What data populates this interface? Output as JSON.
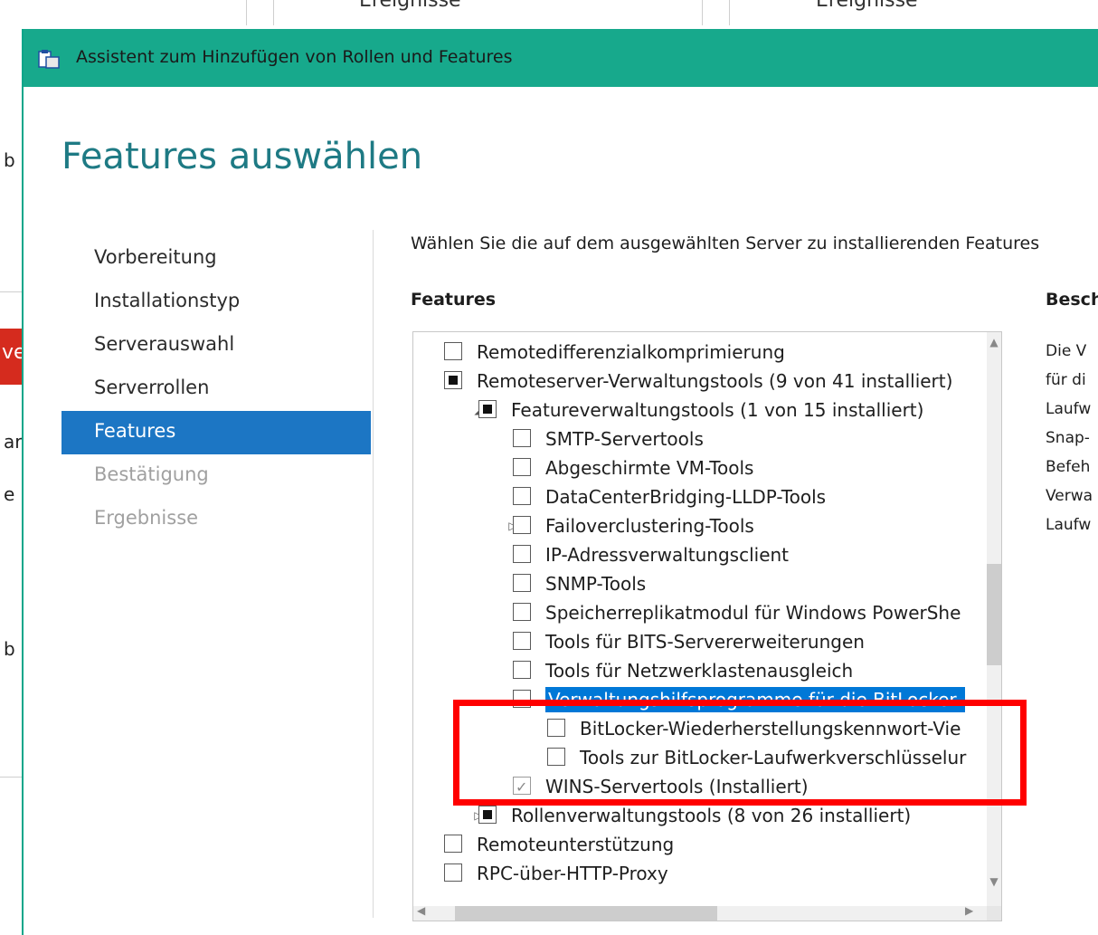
{
  "background": {
    "top_cells": [
      "Ereignisse",
      "Ereignisse"
    ],
    "left_fragments": [
      "b",
      "ar",
      "e",
      "b",
      "ve"
    ]
  },
  "window": {
    "title": "Assistent zum Hinzufügen von Rollen und Features",
    "icon": "wizard-icon",
    "accent_color": "#17a98c"
  },
  "heading": "Features auswählen",
  "nav": {
    "items": [
      {
        "label": "Vorbereitung",
        "state": "normal"
      },
      {
        "label": "Installationstyp",
        "state": "normal"
      },
      {
        "label": "Serverauswahl",
        "state": "normal"
      },
      {
        "label": "Serverrollen",
        "state": "normal"
      },
      {
        "label": "Features",
        "state": "active"
      },
      {
        "label": "Bestätigung",
        "state": "disabled"
      },
      {
        "label": "Ergebnisse",
        "state": "disabled"
      }
    ]
  },
  "main": {
    "instruction": "Wählen Sie die auf dem ausgewählten Server zu installierenden Features",
    "features_heading": "Features",
    "description_heading": "Besch",
    "description_lines": [
      "Die V",
      "für di",
      "Laufw",
      "Snap-",
      "Befeh",
      "Verwa",
      "Laufw"
    ]
  },
  "tree": {
    "items": [
      {
        "label": "Remotedifferenzialkomprimierung",
        "state": "unchecked",
        "expander": "",
        "level": 0
      },
      {
        "label": "Remoteserver-Verwaltungstools (9 von 41 installiert)",
        "state": "partial",
        "expander": "",
        "level": 0
      },
      {
        "label": "Featureverwaltungstools (1 von 15 installiert)",
        "state": "partial",
        "expander": "expanded",
        "level": 1
      },
      {
        "label": "SMTP-Servertools",
        "state": "unchecked",
        "expander": "",
        "level": 2
      },
      {
        "label": "Abgeschirmte VM-Tools",
        "state": "unchecked",
        "expander": "",
        "level": 2
      },
      {
        "label": "DataCenterBridging-LLDP-Tools",
        "state": "unchecked",
        "expander": "",
        "level": 2
      },
      {
        "label": "Failoverclustering-Tools",
        "state": "unchecked",
        "expander": "collapsed",
        "level": 2
      },
      {
        "label": "IP-Adressverwaltungsclient",
        "state": "unchecked",
        "expander": "",
        "level": 2
      },
      {
        "label": "SNMP-Tools",
        "state": "unchecked",
        "expander": "",
        "level": 2
      },
      {
        "label": "Speicherreplikatmodul für Windows PowerShe",
        "state": "unchecked",
        "expander": "",
        "level": 2
      },
      {
        "label": "Tools für BITS-Servererweiterungen",
        "state": "unchecked",
        "expander": "",
        "level": 2
      },
      {
        "label": "Tools für Netzwerklastenausgleich",
        "state": "unchecked",
        "expander": "",
        "level": 2
      },
      {
        "label": "Verwaltungshilfsprogramme für die BitLocker-",
        "state": "unchecked",
        "expander": "expanded",
        "level": 2,
        "selected": true
      },
      {
        "label": "BitLocker-Wiederherstellungskennwort-Vie",
        "state": "unchecked",
        "expander": "",
        "level": 3
      },
      {
        "label": "Tools zur BitLocker-Laufwerkverschlüsselur",
        "state": "unchecked",
        "expander": "",
        "level": 3
      },
      {
        "label": "WINS-Servertools (Installiert)",
        "state": "checked-disabled",
        "expander": "",
        "level": 2
      },
      {
        "label": "Rollenverwaltungstools (8 von 26 installiert)",
        "state": "partial",
        "expander": "collapsed",
        "level": 1
      },
      {
        "label": "Remoteunterstützung",
        "state": "unchecked",
        "expander": "",
        "level": 0
      },
      {
        "label": "RPC-über-HTTP-Proxy",
        "state": "unchecked",
        "expander": "",
        "level": 0
      }
    ]
  },
  "highlight_color": "#ff0000"
}
